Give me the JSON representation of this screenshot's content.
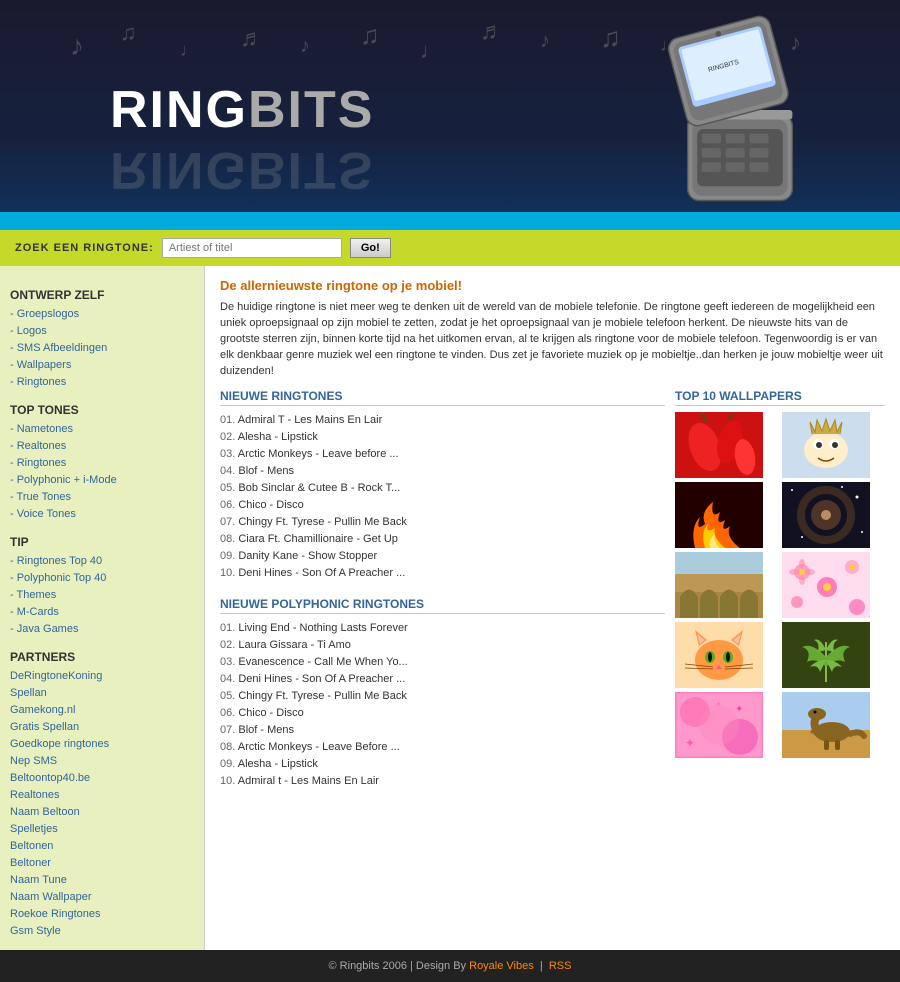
{
  "header": {
    "logo_ring": "RING",
    "logo_bits": "BITS",
    "logo_reflection": "RINGBITS"
  },
  "search": {
    "label": "ZOEK EEN RINGTONE:",
    "placeholder": "Artiest of titel",
    "button_label": "Go!"
  },
  "sidebar": {
    "section1_title": "ONTWERP ZELF",
    "section1_items": [
      "- Groepslogos",
      "- Logos",
      "- SMS Afbeeldingen",
      "- Wallpapers",
      "- Ringtones"
    ],
    "section2_title": "TOP TONES",
    "section2_items": [
      "- Nametones",
      "- Realtones",
      "- Ringtones",
      "- Polyphonic + i-Mode",
      "- True Tones",
      "- Voice Tones"
    ],
    "section3_title": "TIP",
    "section3_items": [
      "- Ringtones Top 40",
      "- Polyphonic Top 40",
      "- Themes",
      "- M-Cards",
      "- Java Games"
    ],
    "section4_title": "PARTNERS",
    "section4_items": [
      "DeRingtoneKoning",
      "Spellan",
      "Gamekong.nl",
      "Gratis Spellan",
      "Goedkope ringtones",
      "Nep SMS",
      "Beltoontop40.be",
      "Realtones",
      "Naam Beltoon",
      "Spelletjes",
      "Beltonen",
      "Beltoner",
      "Naam Tune",
      "Naam Wallpaper",
      "Roekoe Ringtones",
      "Gsm Style"
    ]
  },
  "content": {
    "intro_title": "De allernieuwste ringtone op je mobiel!",
    "intro_text": "De huidige ringtone is niet meer weg te denken uit de wereld van de mobiele telefonie. De ringtone geeft iedereen de mogelijkheid een uniek oproepsignaal op zijn mobiel te zetten, zodat je het oproepsignaal van je mobiele telefoon herkent. De nieuwste hits van de grootste sterren zijn, binnen korte tijd na het uitkomen ervan, al te krijgen als ringtone voor de mobiele telefoon. Tegenwoordig is er van elk denkbaar genre muziek wel een ringtone te vinden. Dus zet je favoriete muziek op je mobieltje..dan herken je jouw mobieltje weer uit duizenden!",
    "new_ringtones_title": "NIEUWE RINGTONES",
    "new_ringtones": [
      {
        "num": "01.",
        "text": "Admiral T - Les Mains En Lair"
      },
      {
        "num": "02.",
        "text": "Alesha - Lipstick"
      },
      {
        "num": "03.",
        "text": "Arctic Monkeys - Leave before ..."
      },
      {
        "num": "04.",
        "text": "Blof - Mens"
      },
      {
        "num": "05.",
        "text": "Bob Sinclar & Cutee B - Rock T..."
      },
      {
        "num": "06.",
        "text": "Chico - Disco"
      },
      {
        "num": "07.",
        "text": "Chingy Ft. Tyrese - Pullin Me Back"
      },
      {
        "num": "08.",
        "text": "Ciara Ft. Chamillionaire - Get Up"
      },
      {
        "num": "09.",
        "text": "Danity Kane - Show Stopper"
      },
      {
        "num": "10.",
        "text": "Deni Hines - Son Of A Preacher ..."
      }
    ],
    "new_polyphonic_title": "NIEUWE POLYPHONIC RINGTONES",
    "new_polyphonic": [
      {
        "num": "01.",
        "text": "Living End - Nothing Lasts Forever"
      },
      {
        "num": "02.",
        "text": "Laura Gissara - Ti Amo"
      },
      {
        "num": "03.",
        "text": "Evanescence - Call Me When Yo..."
      },
      {
        "num": "04.",
        "text": "Deni Hines - Son Of A Preacher ..."
      },
      {
        "num": "05.",
        "text": "Chingy Ft. Tyrese - Pullin Me Back"
      },
      {
        "num": "06.",
        "text": "Chico - Disco"
      },
      {
        "num": "07.",
        "text": "Blof - Mens"
      },
      {
        "num": "08.",
        "text": "Arctic Monkeys - Leave Before ..."
      },
      {
        "num": "09.",
        "text": "Alesha - Lipstick"
      },
      {
        "num": "10.",
        "text": "Admiral t - Les Mains En Lair"
      }
    ],
    "top10_wallpapers_title": "TOP 10 WALLPAPERS"
  },
  "footer": {
    "text": "© Ringbits 2006 | Design By",
    "designer": "Royale Vibes",
    "rss": "RSS"
  },
  "music_notes": [
    "♪",
    "♫",
    "♩",
    "♬",
    "♪",
    "♫",
    "♩",
    "♬",
    "♪",
    "♫",
    "♩"
  ]
}
